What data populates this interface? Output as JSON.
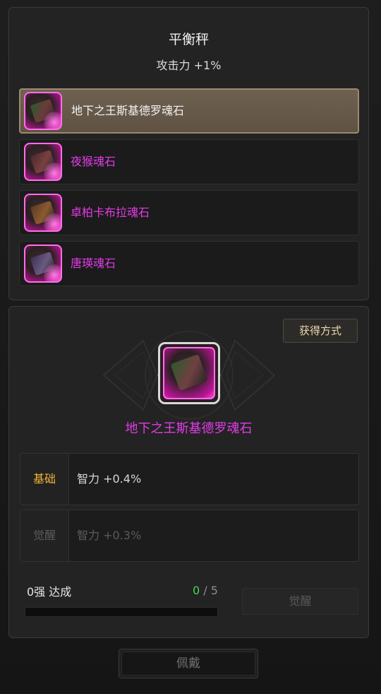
{
  "header": {
    "title": "平衡秤",
    "subtitle": "攻击力 +1%"
  },
  "soulstones": [
    {
      "label": "地下之王斯基德罗魂石",
      "selected": true
    },
    {
      "label": "夜猴魂石",
      "selected": false
    },
    {
      "label": "卓柏卡布拉魂石",
      "selected": false
    },
    {
      "label": "唐瑛魂石",
      "selected": false
    }
  ],
  "detail": {
    "acquire_label": "获得方式",
    "gem_name": "地下之王斯基德罗魂石",
    "base_tag": "基础",
    "base_value": "智力 +0.4%",
    "awaken_tag": "觉醒",
    "awaken_value": "智力 +0.3%"
  },
  "progress": {
    "label": "0强 达成",
    "current": "0",
    "total": "/ 5",
    "fraction": 0
  },
  "buttons": {
    "awaken_label": "觉醒",
    "equip_label": "佩戴"
  },
  "colors": {
    "rarity_magenta": "#e33be8",
    "base_tag": "#f0b43a",
    "progress_current": "#40d94a",
    "selected_row": "#6f6150"
  },
  "icons": {
    "gem": "soulstone-icon"
  }
}
